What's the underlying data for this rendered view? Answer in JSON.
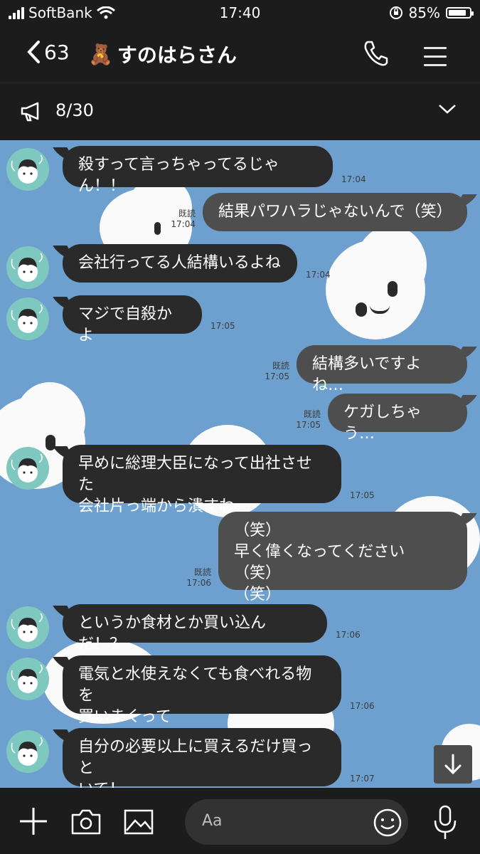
{
  "status": {
    "carrier": "SoftBank",
    "time": "17:40",
    "battery": "85%",
    "battery_level": 0.85
  },
  "header": {
    "back_count": "63",
    "title_emoji": "🧸",
    "title": "すのはらさん",
    "icons": [
      "back-chevron-icon",
      "phone-icon",
      "hamburger-menu-icon"
    ]
  },
  "announcement": {
    "count": "8/30",
    "icons": [
      "megaphone-icon",
      "chevron-down-icon"
    ]
  },
  "messages": [
    {
      "side": "in",
      "text": "殺すって言っちゃってるじゃん！！",
      "time": "17:04"
    },
    {
      "side": "out",
      "text": "結果パワハラじゃないんで（笑）",
      "read": "既読",
      "time": "17:04"
    },
    {
      "side": "in",
      "text": "会社行ってる人結構いるよね",
      "time": "17:04"
    },
    {
      "side": "in",
      "text": "マジで自殺かよ",
      "time": "17:05"
    },
    {
      "side": "out",
      "text": "結構多いですよね…",
      "read": "既読",
      "time": "17:05"
    },
    {
      "side": "out",
      "text": "ケガしちゃう…",
      "read": "既読",
      "time": "17:05"
    },
    {
      "side": "in",
      "text": "早めに総理大臣になって出社させた\n会社片っ端から潰すわ",
      "time": "17:05"
    },
    {
      "side": "out",
      "text": "（笑）\n早く偉くなってください（笑）\n（笑）",
      "read": "既読",
      "time": "17:06"
    },
    {
      "side": "in",
      "text": "というか食材とか買い込んだ！？",
      "time": "17:06"
    },
    {
      "side": "in",
      "text": "電気と水使えなくても食べれる物を\n買いまくって",
      "time": "17:06"
    },
    {
      "side": "in",
      "text": "自分の必要以上に買えるだけ買っと\nいて！",
      "time": "17:07"
    }
  ],
  "composer": {
    "placeholder": "Aa",
    "icons": [
      "plus-icon",
      "camera-icon",
      "image-icon",
      "emoji-icon",
      "microphone-icon",
      "scroll-down-arrow-icon"
    ]
  },
  "colors": {
    "chat_background": "#6ea0cf",
    "bar_background": "#1c1c1c",
    "incoming_bubble": "#2a2a2a",
    "outgoing_bubble": "#4e4e4e",
    "avatar": "#7fc8bf"
  }
}
